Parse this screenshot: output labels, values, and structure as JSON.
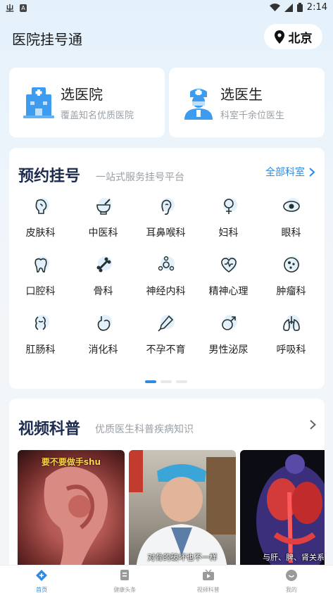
{
  "status_bar": {
    "time": "2:14",
    "left_icons": [
      "app-icon",
      "a-icon"
    ],
    "right_icons": [
      "wifi-icon",
      "signal-icon",
      "battery-icon"
    ]
  },
  "header": {
    "title": "医院挂号通",
    "city": "北京",
    "city_icon": "location-pin-icon"
  },
  "top_cards": [
    {
      "title": "选医院",
      "subtitle": "覆盖知名优质医院",
      "icon": "hospital-icon"
    },
    {
      "title": "选医生",
      "subtitle": "科室千余位医生",
      "icon": "doctor-icon"
    }
  ],
  "appointment": {
    "title": "预约挂号",
    "subtitle": "一站式服务挂号平台",
    "all_link": "全部科室",
    "departments": [
      {
        "label": "皮肤科",
        "icon": "face-icon"
      },
      {
        "label": "中医科",
        "icon": "mortar-icon"
      },
      {
        "label": "耳鼻喉科",
        "icon": "ear-icon"
      },
      {
        "label": "妇科",
        "icon": "female-icon"
      },
      {
        "label": "眼科",
        "icon": "eye-icon"
      },
      {
        "label": "口腔科",
        "icon": "tooth-icon"
      },
      {
        "label": "骨科",
        "icon": "bone-icon"
      },
      {
        "label": "神经内科",
        "icon": "neuron-icon"
      },
      {
        "label": "精神心理",
        "icon": "heart-pulse-icon"
      },
      {
        "label": "肿瘤科",
        "icon": "cell-icon"
      },
      {
        "label": "肛肠科",
        "icon": "intestine-icon"
      },
      {
        "label": "消化科",
        "icon": "stomach-icon"
      },
      {
        "label": "不孕不育",
        "icon": "thermometer-icon"
      },
      {
        "label": "男性泌尿",
        "icon": "male-icon"
      },
      {
        "label": "呼吸科",
        "icon": "lungs-icon"
      }
    ],
    "page_count": 3,
    "active_page": 0
  },
  "video": {
    "title": "视频科普",
    "subtitle": "优质医生科普疾病知识",
    "thumbs": [
      {
        "top_caption": "要不要做手shu",
        "caption": ""
      },
      {
        "top_caption": "",
        "caption": "对骨的破坏也不一样"
      },
      {
        "top_caption": "",
        "caption": "与肝、脾、肾关系"
      }
    ]
  },
  "bottom_nav": [
    {
      "label": "首页",
      "icon": "home-icon",
      "active": true
    },
    {
      "label": "健康头条",
      "icon": "news-icon",
      "active": false
    },
    {
      "label": "视频科普",
      "icon": "video-icon",
      "active": false
    },
    {
      "label": "我的",
      "icon": "profile-icon",
      "active": false
    }
  ],
  "colors": {
    "accent": "#2f8ae2",
    "title_dark": "#1d2b4f",
    "icon_bg": "#e3f0fb"
  }
}
